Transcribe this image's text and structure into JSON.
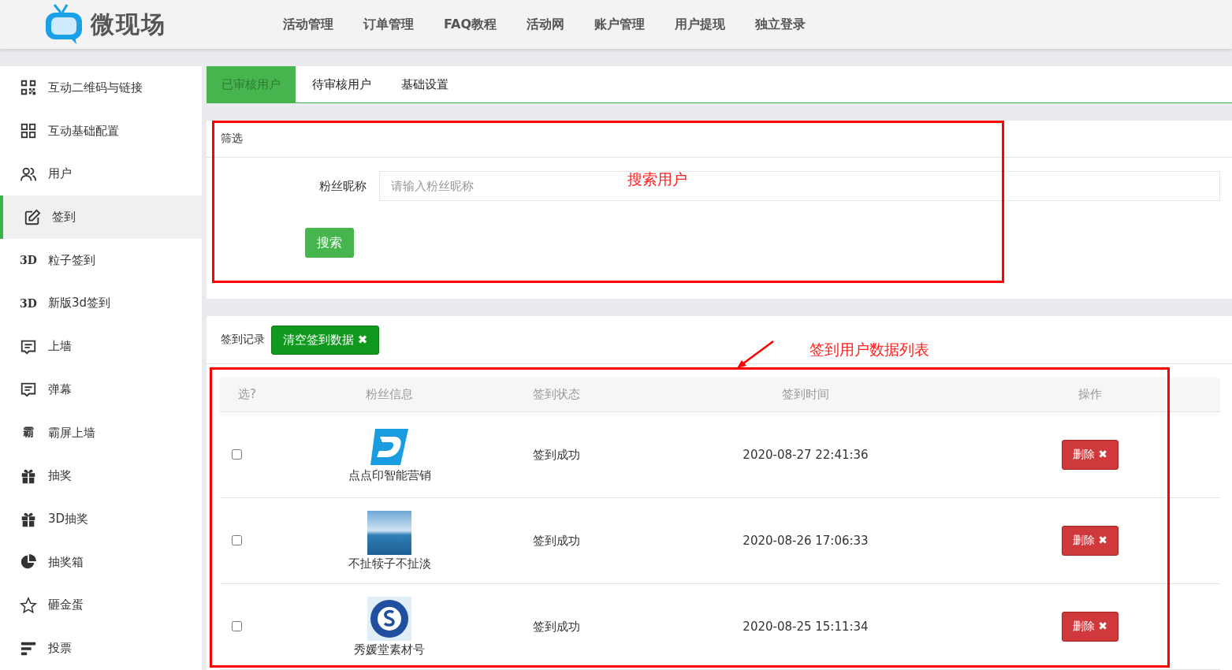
{
  "logo": {
    "text": "微现场"
  },
  "nav": [
    "活动管理",
    "订单管理",
    "FAQ教程",
    "活动网",
    "账户管理",
    "用户提现",
    "独立登录"
  ],
  "sidebar": {
    "items": [
      {
        "label": "互动二维码与链接",
        "kind": "qr",
        "selected": false
      },
      {
        "label": "互动基础配置",
        "kind": "grid",
        "selected": false
      },
      {
        "label": "用户",
        "kind": "users",
        "selected": false
      },
      {
        "label": "签到",
        "kind": "edit",
        "selected": true
      },
      {
        "label": "粒子签到",
        "kind": "text",
        "icon_text": "3D",
        "selected": false
      },
      {
        "label": "新版3d签到",
        "kind": "text",
        "icon_text": "3D",
        "selected": false
      },
      {
        "label": "上墙",
        "kind": "message",
        "selected": false
      },
      {
        "label": "弹幕",
        "kind": "message",
        "selected": false
      },
      {
        "label": "霸屏上墙",
        "kind": "text",
        "icon_text": "霸",
        "selected": false
      },
      {
        "label": "抽奖",
        "kind": "gift",
        "selected": false
      },
      {
        "label": "3D抽奖",
        "kind": "gift",
        "selected": false
      },
      {
        "label": "抽奖箱",
        "kind": "pie",
        "selected": false
      },
      {
        "label": "砸金蛋",
        "kind": "star",
        "selected": false
      },
      {
        "label": "投票",
        "kind": "list",
        "selected": false
      }
    ]
  },
  "tabs": [
    {
      "label": "已审核用户",
      "selected": true
    },
    {
      "label": "待审核用户",
      "selected": false
    },
    {
      "label": "基础设置",
      "selected": false
    }
  ],
  "filter": {
    "title": "筛选",
    "field_label": "粉丝昵称",
    "placeholder": "请输入粉丝昵称",
    "button": "搜索"
  },
  "records": {
    "title": "签到记录",
    "clear_button": "清空签到数据",
    "clear_icon": "✖",
    "columns": [
      "选?",
      "粉丝信息",
      "签到状态",
      "签到时间",
      "操作"
    ],
    "rows": [
      {
        "checked": false,
        "kind": "logo",
        "name": "点点印智能营销",
        "status": "签到成功",
        "time": "2020-08-27 22:41:36",
        "action": "删除",
        "action_icon": "✖"
      },
      {
        "checked": false,
        "kind": "photo",
        "name": "不扯犊子不扯淡",
        "status": "签到成功",
        "time": "2020-08-26 17:06:33",
        "action": "删除",
        "action_icon": "✖"
      },
      {
        "checked": false,
        "kind": "badge",
        "name": "秀媛堂素材号",
        "status": "签到成功",
        "time": "2020-08-25 15:11:34",
        "action": "删除",
        "action_icon": "✖"
      }
    ]
  },
  "annotations": [
    {
      "text": "搜索用户"
    },
    {
      "text": "签到用户数据列表"
    }
  ]
}
